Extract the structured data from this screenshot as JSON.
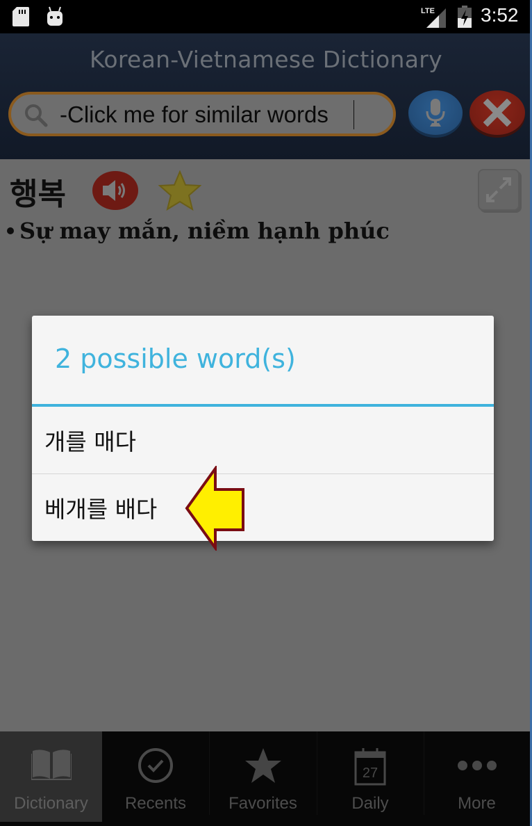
{
  "status_bar": {
    "time": "3:52",
    "network": "LTE",
    "icons": [
      "sd-card-icon",
      "android-debug-icon",
      "lte-signal-icon",
      "battery-charging-icon"
    ]
  },
  "header": {
    "title": "Korean-Vietnamese Dictionary",
    "search": {
      "value": "-Click me for similar words",
      "icon": "search-icon"
    },
    "buttons": {
      "voice": "microphone-icon",
      "clear": "close-icon"
    }
  },
  "entry": {
    "word": "행복",
    "definition": "Sự may mắn, niềm hạnh phúc",
    "icons": [
      "speaker-icon",
      "star-icon",
      "expand-icon"
    ]
  },
  "dialog": {
    "title": "2 possible word(s)",
    "items": [
      {
        "label": "개를 매다"
      },
      {
        "label": "베개를 배다"
      }
    ],
    "colors": {
      "accent": "#3fb3dd"
    }
  },
  "bottom_nav": {
    "tabs": [
      {
        "label": "Dictionary",
        "icon": "book-icon",
        "active": true
      },
      {
        "label": "Recents",
        "icon": "clock-check-icon",
        "active": false
      },
      {
        "label": "Favorites",
        "icon": "star-icon",
        "active": false
      },
      {
        "label": "Daily",
        "icon": "calendar-icon",
        "active": false,
        "badge": "27"
      },
      {
        "label": "More",
        "icon": "more-dots-icon",
        "active": false
      }
    ]
  }
}
